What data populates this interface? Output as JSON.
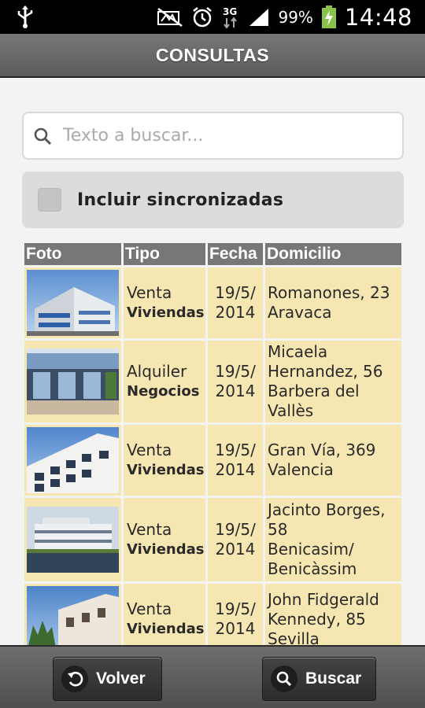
{
  "status_bar": {
    "battery_percent": "99%",
    "network": "3G",
    "time": "14:48",
    "icons": [
      "usb-icon",
      "no-sound-icon",
      "alarm-icon",
      "data-3g-icon",
      "signal-icon",
      "battery-charging-icon"
    ]
  },
  "header": {
    "title": "CONSULTAS"
  },
  "search": {
    "placeholder": "Texto a buscar...",
    "value": ""
  },
  "filter": {
    "label": "Incluir sincronizadas",
    "checked": false
  },
  "table": {
    "headers": [
      "Foto",
      "Tipo",
      "Fecha",
      "Domicilio"
    ],
    "rows": [
      {
        "operation": "Venta",
        "category": "Viviendas",
        "date_l1": "19/5/",
        "date_l2": "2014",
        "address": [
          "Romanones, 23",
          "Aravaca"
        ],
        "photo": "building-photo-1"
      },
      {
        "operation": "Alquiler",
        "category": "Negocios",
        "date_l1": "19/5/",
        "date_l2": "2014",
        "address": [
          "Micaela",
          "Hernandez, 56",
          "Barbera del",
          "Vallès"
        ],
        "photo": "building-photo-2"
      },
      {
        "operation": "Venta",
        "category": "Viviendas",
        "date_l1": "19/5/",
        "date_l2": "2014",
        "address": [
          "Gran Vía, 369",
          "Valencia"
        ],
        "photo": "building-photo-3"
      },
      {
        "operation": "Venta",
        "category": "Viviendas",
        "date_l1": "19/5/",
        "date_l2": "2014",
        "address": [
          "Jacinto Borges,",
          "58",
          "Benicasim/",
          "Benicàssim"
        ],
        "photo": "building-photo-4"
      },
      {
        "operation": "Venta",
        "category": "Viviendas",
        "date_l1": "19/5/",
        "date_l2": "2014",
        "address": [
          "John Fidgerald",
          "Kennedy, 85",
          "Sevilla"
        ],
        "photo": "building-photo-5"
      }
    ]
  },
  "footer": {
    "back_label": "Volver",
    "search_label": "Buscar"
  },
  "colors": {
    "row_bg": "#f5e6b2",
    "header_bg": "#777777",
    "actionbar": "#666666"
  }
}
